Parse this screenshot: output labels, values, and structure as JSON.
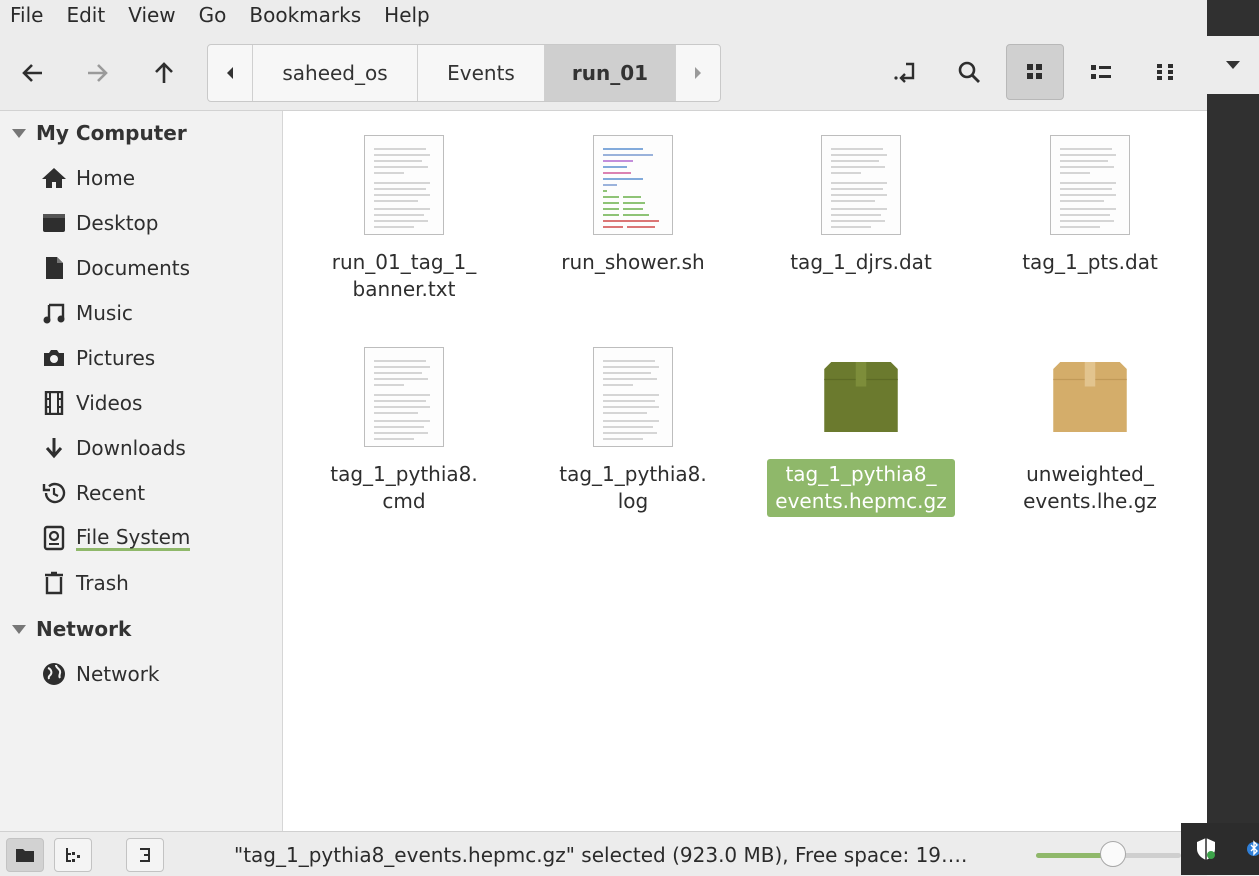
{
  "menu": [
    "File",
    "Edit",
    "View",
    "Go",
    "Bookmarks",
    "Help"
  ],
  "breadcrumb": [
    "saheed_os",
    "Events",
    "run_01"
  ],
  "sidebar": {
    "my_computer": "My Computer",
    "items": [
      "Home",
      "Desktop",
      "Documents",
      "Music",
      "Pictures",
      "Videos",
      "Downloads",
      "Recent",
      "File System",
      "Trash"
    ],
    "network_header": "Network",
    "network_items": [
      "Network"
    ]
  },
  "files": [
    {
      "name": "run_01_tag_1_\nbanner.txt",
      "icon": "text-file-icon"
    },
    {
      "name": "run_shower.sh",
      "icon": "script-file-icon"
    },
    {
      "name": "tag_1_djrs.dat",
      "icon": "text-file-icon"
    },
    {
      "name": "tag_1_pts.dat",
      "icon": "text-file-icon"
    },
    {
      "name": "tag_1_pythia8.\ncmd",
      "icon": "text-file-icon"
    },
    {
      "name": "tag_1_pythia8.\nlog",
      "icon": "text-file-icon"
    },
    {
      "name": "tag_1_pythia8_\nevents.hepmc.gz",
      "icon": "archive-icon",
      "selected": true
    },
    {
      "name": "unweighted_\nevents.lhe.gz",
      "icon": "archive-icon"
    }
  ],
  "status": {
    "text": "\"tag_1_pythia8_events.hepmc.gz\" selected (923.0 MB), Free space: 19….",
    "zoom_fraction": 0.53
  },
  "colors": {
    "accent": "#8fb86a",
    "archive_selected": "#6b7a2e",
    "archive": "#d4ad6a"
  }
}
